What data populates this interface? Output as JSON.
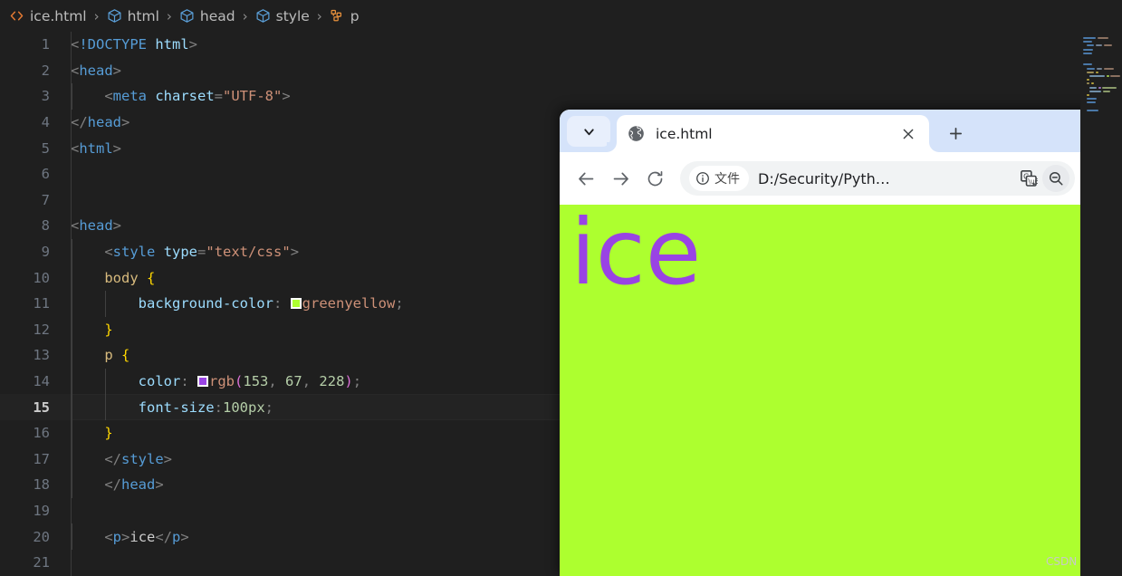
{
  "editor": {
    "breadcrumb": [
      {
        "icon": "html-file-icon",
        "label": "ice.html"
      },
      {
        "icon": "cube-symbol-icon",
        "label": "html"
      },
      {
        "icon": "cube-symbol-icon",
        "label": "head"
      },
      {
        "icon": "cube-symbol-icon",
        "label": "style"
      },
      {
        "icon": "css-selector-icon",
        "label": "p"
      }
    ],
    "separator": "›",
    "active_line": 15,
    "lines": [
      {
        "n": 1,
        "tokens": [
          {
            "t": "punct",
            "v": "<"
          },
          {
            "t": "dd",
            "v": "!DOCTYPE "
          },
          {
            "t": "ddname",
            "v": "html"
          },
          {
            "t": "punct",
            "v": ">"
          }
        ]
      },
      {
        "n": 2,
        "tokens": [
          {
            "t": "punct",
            "v": "<"
          },
          {
            "t": "tag",
            "v": "head"
          },
          {
            "t": "punct",
            "v": ">"
          }
        ]
      },
      {
        "n": 3,
        "tokens": [
          {
            "t": "text",
            "v": "    "
          },
          {
            "t": "punct",
            "v": "<"
          },
          {
            "t": "tag",
            "v": "meta"
          },
          {
            "t": "text",
            "v": " "
          },
          {
            "t": "attr",
            "v": "charset"
          },
          {
            "t": "punct",
            "v": "="
          },
          {
            "t": "str",
            "v": "\"UTF-8\""
          },
          {
            "t": "punct",
            "v": ">"
          }
        ]
      },
      {
        "n": 4,
        "tokens": [
          {
            "t": "punct",
            "v": "</"
          },
          {
            "t": "tag",
            "v": "head"
          },
          {
            "t": "punct",
            "v": ">"
          }
        ]
      },
      {
        "n": 5,
        "tokens": [
          {
            "t": "punct",
            "v": "<"
          },
          {
            "t": "tag",
            "v": "html"
          },
          {
            "t": "punct",
            "v": ">"
          }
        ]
      },
      {
        "n": 6,
        "tokens": []
      },
      {
        "n": 7,
        "tokens": []
      },
      {
        "n": 8,
        "tokens": [
          {
            "t": "punct",
            "v": "<"
          },
          {
            "t": "tag",
            "v": "head"
          },
          {
            "t": "punct",
            "v": ">"
          }
        ]
      },
      {
        "n": 9,
        "tokens": [
          {
            "t": "text",
            "v": "    "
          },
          {
            "t": "punct",
            "v": "<"
          },
          {
            "t": "tag",
            "v": "style"
          },
          {
            "t": "text",
            "v": " "
          },
          {
            "t": "attr",
            "v": "type"
          },
          {
            "t": "punct",
            "v": "="
          },
          {
            "t": "str",
            "v": "\"text/css\""
          },
          {
            "t": "punct",
            "v": ">"
          }
        ]
      },
      {
        "n": 10,
        "tokens": [
          {
            "t": "text",
            "v": "    "
          },
          {
            "t": "sel",
            "v": "body"
          },
          {
            "t": "text",
            "v": " "
          },
          {
            "t": "brace",
            "v": "{"
          }
        ]
      },
      {
        "n": 11,
        "tokens": [
          {
            "t": "text",
            "v": "        "
          },
          {
            "t": "prop",
            "v": "background-color"
          },
          {
            "t": "punct",
            "v": ":"
          },
          {
            "t": "text",
            "v": " "
          },
          {
            "t": "swatch",
            "v": "#adff2f"
          },
          {
            "t": "val",
            "v": "greenyellow"
          },
          {
            "t": "punct",
            "v": ";"
          }
        ]
      },
      {
        "n": 12,
        "tokens": [
          {
            "t": "text",
            "v": "    "
          },
          {
            "t": "brace",
            "v": "}"
          }
        ]
      },
      {
        "n": 13,
        "tokens": [
          {
            "t": "text",
            "v": "    "
          },
          {
            "t": "sel",
            "v": "p"
          },
          {
            "t": "text",
            "v": " "
          },
          {
            "t": "brace",
            "v": "{"
          }
        ]
      },
      {
        "n": 14,
        "tokens": [
          {
            "t": "text",
            "v": "        "
          },
          {
            "t": "prop",
            "v": "color"
          },
          {
            "t": "punct",
            "v": ":"
          },
          {
            "t": "text",
            "v": " "
          },
          {
            "t": "swatch",
            "v": "rgb(153, 67, 228)"
          },
          {
            "t": "val",
            "v": "rgb"
          },
          {
            "t": "fnparen",
            "v": "("
          },
          {
            "t": "num",
            "v": "153"
          },
          {
            "t": "punct",
            "v": ","
          },
          {
            "t": "text",
            "v": " "
          },
          {
            "t": "num",
            "v": "67"
          },
          {
            "t": "punct",
            "v": ","
          },
          {
            "t": "text",
            "v": " "
          },
          {
            "t": "num",
            "v": "228"
          },
          {
            "t": "fnparen",
            "v": ")"
          },
          {
            "t": "punct",
            "v": ";"
          }
        ]
      },
      {
        "n": 15,
        "tokens": [
          {
            "t": "text",
            "v": "        "
          },
          {
            "t": "prop",
            "v": "font-size"
          },
          {
            "t": "punct",
            "v": ":"
          },
          {
            "t": "num",
            "v": "100px"
          },
          {
            "t": "punct",
            "v": ";"
          }
        ]
      },
      {
        "n": 16,
        "tokens": [
          {
            "t": "text",
            "v": "    "
          },
          {
            "t": "brace",
            "v": "}"
          }
        ]
      },
      {
        "n": 17,
        "tokens": [
          {
            "t": "text",
            "v": "    "
          },
          {
            "t": "punct",
            "v": "</"
          },
          {
            "t": "tag",
            "v": "style"
          },
          {
            "t": "punct",
            "v": ">"
          }
        ]
      },
      {
        "n": 18,
        "tokens": [
          {
            "t": "text",
            "v": "    "
          },
          {
            "t": "punct",
            "v": "</"
          },
          {
            "t": "tag",
            "v": "head"
          },
          {
            "t": "punct",
            "v": ">"
          }
        ]
      },
      {
        "n": 19,
        "tokens": []
      },
      {
        "n": 20,
        "tokens": [
          {
            "t": "text",
            "v": "    "
          },
          {
            "t": "punct",
            "v": "<"
          },
          {
            "t": "tag",
            "v": "p"
          },
          {
            "t": "punct",
            "v": ">"
          },
          {
            "t": "text",
            "v": "ice"
          },
          {
            "t": "punct",
            "v": "</"
          },
          {
            "t": "tag",
            "v": "p"
          },
          {
            "t": "punct",
            "v": ">"
          }
        ]
      },
      {
        "n": 21,
        "tokens": []
      }
    ]
  },
  "browser": {
    "tab_list_icon": "chevron-down-icon",
    "tab": {
      "favicon": "globe-icon",
      "title": "ice.html",
      "close_icon": "close-icon"
    },
    "new_tab_icon": "plus-icon",
    "toolbar": {
      "back_icon": "arrow-left-icon",
      "forward_icon": "arrow-right-icon",
      "reload_icon": "reload-icon",
      "info_icon": "info-circle-icon",
      "chip_label": "文件",
      "url": "D:/Security/Pyth…",
      "translate_icon": "translate-icon",
      "zoom_icon": "zoom-out-icon",
      "bookmark_icon": "star-icon"
    },
    "page": {
      "background_color": "#adff2f",
      "text": "ice",
      "text_color": "rgb(153, 67, 228)",
      "font_size": "100px",
      "watermark": "CSDN @秋说"
    }
  }
}
